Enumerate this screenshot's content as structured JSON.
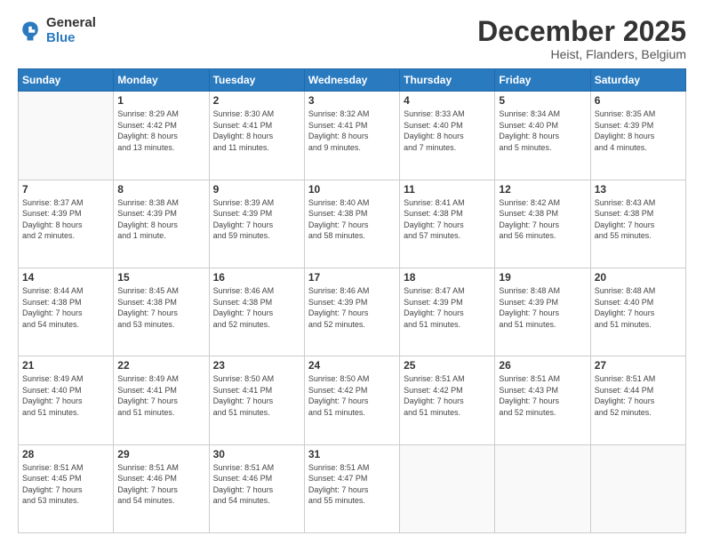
{
  "logo": {
    "general": "General",
    "blue": "Blue"
  },
  "header": {
    "month": "December 2025",
    "location": "Heist, Flanders, Belgium"
  },
  "days_of_week": [
    "Sunday",
    "Monday",
    "Tuesday",
    "Wednesday",
    "Thursday",
    "Friday",
    "Saturday"
  ],
  "weeks": [
    [
      {
        "day": "",
        "info": ""
      },
      {
        "day": "1",
        "info": "Sunrise: 8:29 AM\nSunset: 4:42 PM\nDaylight: 8 hours\nand 13 minutes."
      },
      {
        "day": "2",
        "info": "Sunrise: 8:30 AM\nSunset: 4:41 PM\nDaylight: 8 hours\nand 11 minutes."
      },
      {
        "day": "3",
        "info": "Sunrise: 8:32 AM\nSunset: 4:41 PM\nDaylight: 8 hours\nand 9 minutes."
      },
      {
        "day": "4",
        "info": "Sunrise: 8:33 AM\nSunset: 4:40 PM\nDaylight: 8 hours\nand 7 minutes."
      },
      {
        "day": "5",
        "info": "Sunrise: 8:34 AM\nSunset: 4:40 PM\nDaylight: 8 hours\nand 5 minutes."
      },
      {
        "day": "6",
        "info": "Sunrise: 8:35 AM\nSunset: 4:39 PM\nDaylight: 8 hours\nand 4 minutes."
      }
    ],
    [
      {
        "day": "7",
        "info": "Sunrise: 8:37 AM\nSunset: 4:39 PM\nDaylight: 8 hours\nand 2 minutes."
      },
      {
        "day": "8",
        "info": "Sunrise: 8:38 AM\nSunset: 4:39 PM\nDaylight: 8 hours\nand 1 minute."
      },
      {
        "day": "9",
        "info": "Sunrise: 8:39 AM\nSunset: 4:39 PM\nDaylight: 7 hours\nand 59 minutes."
      },
      {
        "day": "10",
        "info": "Sunrise: 8:40 AM\nSunset: 4:38 PM\nDaylight: 7 hours\nand 58 minutes."
      },
      {
        "day": "11",
        "info": "Sunrise: 8:41 AM\nSunset: 4:38 PM\nDaylight: 7 hours\nand 57 minutes."
      },
      {
        "day": "12",
        "info": "Sunrise: 8:42 AM\nSunset: 4:38 PM\nDaylight: 7 hours\nand 56 minutes."
      },
      {
        "day": "13",
        "info": "Sunrise: 8:43 AM\nSunset: 4:38 PM\nDaylight: 7 hours\nand 55 minutes."
      }
    ],
    [
      {
        "day": "14",
        "info": "Sunrise: 8:44 AM\nSunset: 4:38 PM\nDaylight: 7 hours\nand 54 minutes."
      },
      {
        "day": "15",
        "info": "Sunrise: 8:45 AM\nSunset: 4:38 PM\nDaylight: 7 hours\nand 53 minutes."
      },
      {
        "day": "16",
        "info": "Sunrise: 8:46 AM\nSunset: 4:38 PM\nDaylight: 7 hours\nand 52 minutes."
      },
      {
        "day": "17",
        "info": "Sunrise: 8:46 AM\nSunset: 4:39 PM\nDaylight: 7 hours\nand 52 minutes."
      },
      {
        "day": "18",
        "info": "Sunrise: 8:47 AM\nSunset: 4:39 PM\nDaylight: 7 hours\nand 51 minutes."
      },
      {
        "day": "19",
        "info": "Sunrise: 8:48 AM\nSunset: 4:39 PM\nDaylight: 7 hours\nand 51 minutes."
      },
      {
        "day": "20",
        "info": "Sunrise: 8:48 AM\nSunset: 4:40 PM\nDaylight: 7 hours\nand 51 minutes."
      }
    ],
    [
      {
        "day": "21",
        "info": "Sunrise: 8:49 AM\nSunset: 4:40 PM\nDaylight: 7 hours\nand 51 minutes."
      },
      {
        "day": "22",
        "info": "Sunrise: 8:49 AM\nSunset: 4:41 PM\nDaylight: 7 hours\nand 51 minutes."
      },
      {
        "day": "23",
        "info": "Sunrise: 8:50 AM\nSunset: 4:41 PM\nDaylight: 7 hours\nand 51 minutes."
      },
      {
        "day": "24",
        "info": "Sunrise: 8:50 AM\nSunset: 4:42 PM\nDaylight: 7 hours\nand 51 minutes."
      },
      {
        "day": "25",
        "info": "Sunrise: 8:51 AM\nSunset: 4:42 PM\nDaylight: 7 hours\nand 51 minutes."
      },
      {
        "day": "26",
        "info": "Sunrise: 8:51 AM\nSunset: 4:43 PM\nDaylight: 7 hours\nand 52 minutes."
      },
      {
        "day": "27",
        "info": "Sunrise: 8:51 AM\nSunset: 4:44 PM\nDaylight: 7 hours\nand 52 minutes."
      }
    ],
    [
      {
        "day": "28",
        "info": "Sunrise: 8:51 AM\nSunset: 4:45 PM\nDaylight: 7 hours\nand 53 minutes."
      },
      {
        "day": "29",
        "info": "Sunrise: 8:51 AM\nSunset: 4:46 PM\nDaylight: 7 hours\nand 54 minutes."
      },
      {
        "day": "30",
        "info": "Sunrise: 8:51 AM\nSunset: 4:46 PM\nDaylight: 7 hours\nand 54 minutes."
      },
      {
        "day": "31",
        "info": "Sunrise: 8:51 AM\nSunset: 4:47 PM\nDaylight: 7 hours\nand 55 minutes."
      },
      {
        "day": "",
        "info": ""
      },
      {
        "day": "",
        "info": ""
      },
      {
        "day": "",
        "info": ""
      }
    ]
  ]
}
